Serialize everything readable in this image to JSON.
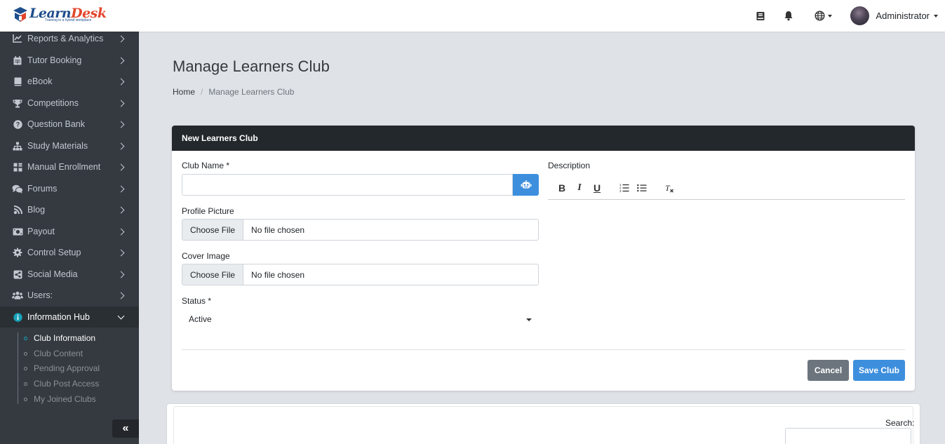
{
  "brand": {
    "name_part1": "Learn",
    "name_part2": "Desk",
    "tagline": "Training in a hybrid workplace"
  },
  "topbar": {
    "icons": [
      "book-icon",
      "bell-icon",
      "globe-icon"
    ],
    "user_name": "Administrator"
  },
  "sidebar": {
    "items": [
      {
        "label": "Reports & Analytics",
        "icon": "chart-icon"
      },
      {
        "label": "Tutor Booking",
        "icon": "calendar-icon"
      },
      {
        "label": "eBook",
        "icon": "book-icon"
      },
      {
        "label": "Competitions",
        "icon": "trophy-icon"
      },
      {
        "label": "Question Bank",
        "icon": "question-icon"
      },
      {
        "label": "Study Materials",
        "icon": "sitemap-icon"
      },
      {
        "label": "Manual Enrollment",
        "icon": "grid-icon"
      },
      {
        "label": "Forums",
        "icon": "comments-icon"
      },
      {
        "label": "Blog",
        "icon": "blog-icon"
      },
      {
        "label": "Payout",
        "icon": "money-icon"
      },
      {
        "label": "Control Setup",
        "icon": "gear-icon"
      },
      {
        "label": "Social Media",
        "icon": "share-icon"
      },
      {
        "label": "Users:",
        "icon": "users-icon"
      },
      {
        "label": "Information Hub",
        "icon": "info-icon"
      }
    ],
    "sub_items": [
      {
        "label": "Club Information"
      },
      {
        "label": "Club Content"
      },
      {
        "label": "Pending Approval"
      },
      {
        "label": "Club Post Access"
      },
      {
        "label": "My Joined Clubs"
      }
    ],
    "collapse_label": "«"
  },
  "page": {
    "title": "Manage Learners Club",
    "breadcrumb": {
      "home": "Home",
      "separator": "/",
      "current": "Manage Learners Club"
    }
  },
  "form": {
    "header": "New Learners Club",
    "club_name_label": "Club Name *",
    "club_name_value": "",
    "profile_picture_label": "Profile Picture",
    "cover_image_label": "Cover Image",
    "choose_file": "Choose File",
    "no_file": "No file chosen",
    "status_label": "Status *",
    "status_value": "Active",
    "description_label": "Description",
    "toolbar": {
      "bold": "B",
      "italic": "I",
      "underline": "U"
    },
    "cancel_label": "Cancel",
    "save_label": "Save Club"
  },
  "list": {
    "search_label": "Search:",
    "search_value": ""
  },
  "colors": {
    "sidebar_bg": "#343a40",
    "header_bg": "#23282d",
    "primary": "#3d8fde",
    "secondary": "#6c757d",
    "accent_info": "#17a2b8"
  }
}
